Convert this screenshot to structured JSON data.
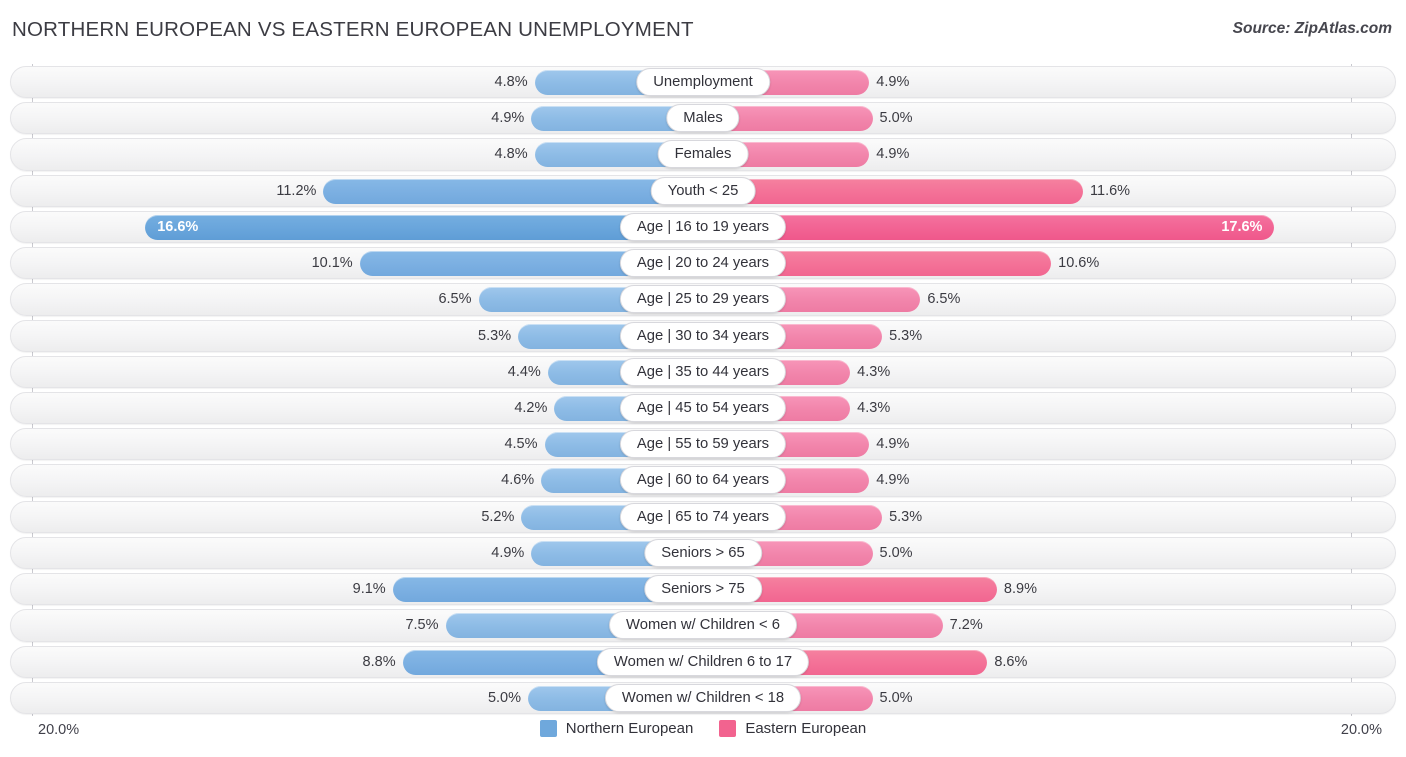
{
  "header": {
    "title": "NORTHERN EUROPEAN VS EASTERN EUROPEAN UNEMPLOYMENT",
    "source": "Source: ZipAtlas.com"
  },
  "axis": {
    "left_label": "20.0%",
    "right_label": "20.0%",
    "max": 20.0
  },
  "legend": {
    "items": [
      {
        "label": "Northern European",
        "color": "#6fa8dc"
      },
      {
        "label": "Eastern European",
        "color": "#f2638f"
      }
    ]
  },
  "chart_data": {
    "type": "bar",
    "orientation": "horizontal-diverging",
    "title": "NORTHERN EUROPEAN VS EASTERN EUROPEAN UNEMPLOYMENT",
    "xlabel": "",
    "ylabel": "",
    "xlim": [
      0,
      20.0
    ],
    "grid": false,
    "legend_position": "bottom-center",
    "categories": [
      "Unemployment",
      "Males",
      "Females",
      "Youth < 25",
      "Age | 16 to 19 years",
      "Age | 20 to 24 years",
      "Age | 25 to 29 years",
      "Age | 30 to 34 years",
      "Age | 35 to 44 years",
      "Age | 45 to 54 years",
      "Age | 55 to 59 years",
      "Age | 60 to 64 years",
      "Age | 65 to 74 years",
      "Seniors > 65",
      "Seniors > 75",
      "Women w/ Children < 6",
      "Women w/ Children 6 to 17",
      "Women w/ Children < 18"
    ],
    "series": [
      {
        "name": "Northern European",
        "color": "#6fa8dc",
        "values": [
          4.8,
          4.9,
          4.8,
          11.2,
          16.6,
          10.1,
          6.5,
          5.3,
          4.4,
          4.2,
          4.5,
          4.6,
          5.2,
          4.9,
          9.1,
          7.5,
          8.8,
          5.0
        ]
      },
      {
        "name": "Eastern European",
        "color": "#f2638f",
        "values": [
          4.9,
          5.0,
          4.9,
          11.6,
          17.6,
          10.6,
          6.5,
          5.3,
          4.3,
          4.3,
          4.9,
          4.9,
          5.3,
          5.0,
          8.9,
          7.2,
          8.6,
          5.0
        ]
      }
    ]
  },
  "rows": [
    {
      "label": "Unemployment",
      "left": "4.8%",
      "right": "4.9%",
      "left_val": 4.8,
      "right_val": 4.9,
      "emphasis": "normal"
    },
    {
      "label": "Males",
      "left": "4.9%",
      "right": "5.0%",
      "left_val": 4.9,
      "right_val": 5.0,
      "emphasis": "normal"
    },
    {
      "label": "Females",
      "left": "4.8%",
      "right": "4.9%",
      "left_val": 4.8,
      "right_val": 4.9,
      "emphasis": "normal"
    },
    {
      "label": "Youth < 25",
      "left": "11.2%",
      "right": "11.6%",
      "left_val": 11.2,
      "right_val": 11.6,
      "emphasis": "strong"
    },
    {
      "label": "Age | 16 to 19 years",
      "left": "16.6%",
      "right": "17.6%",
      "left_val": 16.6,
      "right_val": 17.6,
      "emphasis": "max"
    },
    {
      "label": "Age | 20 to 24 years",
      "left": "10.1%",
      "right": "10.6%",
      "left_val": 10.1,
      "right_val": 10.6,
      "emphasis": "strong"
    },
    {
      "label": "Age | 25 to 29 years",
      "left": "6.5%",
      "right": "6.5%",
      "left_val": 6.5,
      "right_val": 6.5,
      "emphasis": "normal"
    },
    {
      "label": "Age | 30 to 34 years",
      "left": "5.3%",
      "right": "5.3%",
      "left_val": 5.3,
      "right_val": 5.3,
      "emphasis": "normal"
    },
    {
      "label": "Age | 35 to 44 years",
      "left": "4.4%",
      "right": "4.3%",
      "left_val": 4.4,
      "right_val": 4.3,
      "emphasis": "normal"
    },
    {
      "label": "Age | 45 to 54 years",
      "left": "4.2%",
      "right": "4.3%",
      "left_val": 4.2,
      "right_val": 4.3,
      "emphasis": "normal"
    },
    {
      "label": "Age | 55 to 59 years",
      "left": "4.5%",
      "right": "4.9%",
      "left_val": 4.5,
      "right_val": 4.9,
      "emphasis": "normal"
    },
    {
      "label": "Age | 60 to 64 years",
      "left": "4.6%",
      "right": "4.9%",
      "left_val": 4.6,
      "right_val": 4.9,
      "emphasis": "normal"
    },
    {
      "label": "Age | 65 to 74 years",
      "left": "5.2%",
      "right": "5.3%",
      "left_val": 5.2,
      "right_val": 5.3,
      "emphasis": "normal"
    },
    {
      "label": "Seniors > 65",
      "left": "4.9%",
      "right": "5.0%",
      "left_val": 4.9,
      "right_val": 5.0,
      "emphasis": "normal"
    },
    {
      "label": "Seniors > 75",
      "left": "9.1%",
      "right": "8.9%",
      "left_val": 9.1,
      "right_val": 8.9,
      "emphasis": "strong"
    },
    {
      "label": "Women w/ Children < 6",
      "left": "7.5%",
      "right": "7.2%",
      "left_val": 7.5,
      "right_val": 7.2,
      "emphasis": "normal"
    },
    {
      "label": "Women w/ Children 6 to 17",
      "left": "8.8%",
      "right": "8.6%",
      "left_val": 8.8,
      "right_val": 8.6,
      "emphasis": "strong"
    },
    {
      "label": "Women w/ Children < 18",
      "left": "5.0%",
      "right": "5.0%",
      "left_val": 5.0,
      "right_val": 5.0,
      "emphasis": "normal"
    }
  ]
}
